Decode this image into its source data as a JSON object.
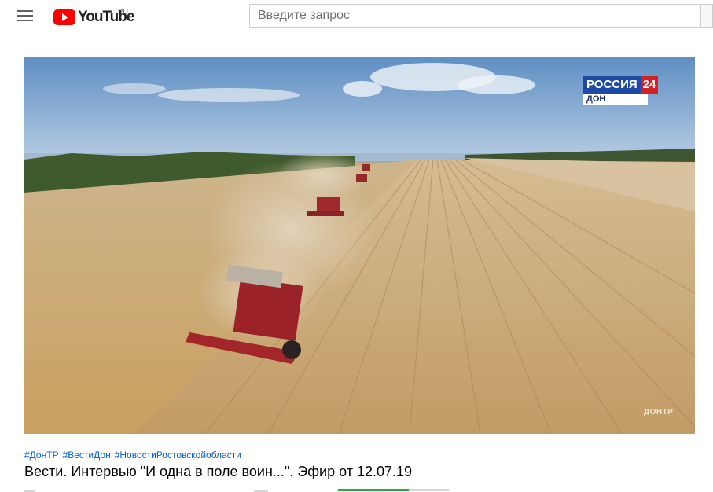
{
  "header": {
    "menu_icon": "hamburger-menu-icon",
    "logo_text": "YouTube",
    "logo_region": "RU",
    "search_placeholder": "Введите запрос",
    "search_value": ""
  },
  "player": {
    "channel_badge": {
      "name": "РОССИЯ",
      "number": "24",
      "region": "ДОН"
    },
    "watermark": "ДОНТР"
  },
  "video": {
    "hashtags": [
      "#ДонТР",
      "#ВестиДон",
      "#НовостиРостовскойобласти"
    ],
    "title": "Вести. Интервью \"И одна в поле воин...\". Эфир от 12.07.19"
  },
  "colors": {
    "brand_red": "#ff0000",
    "link_blue": "#065fd4",
    "like_bar_green": "#2ba640"
  }
}
